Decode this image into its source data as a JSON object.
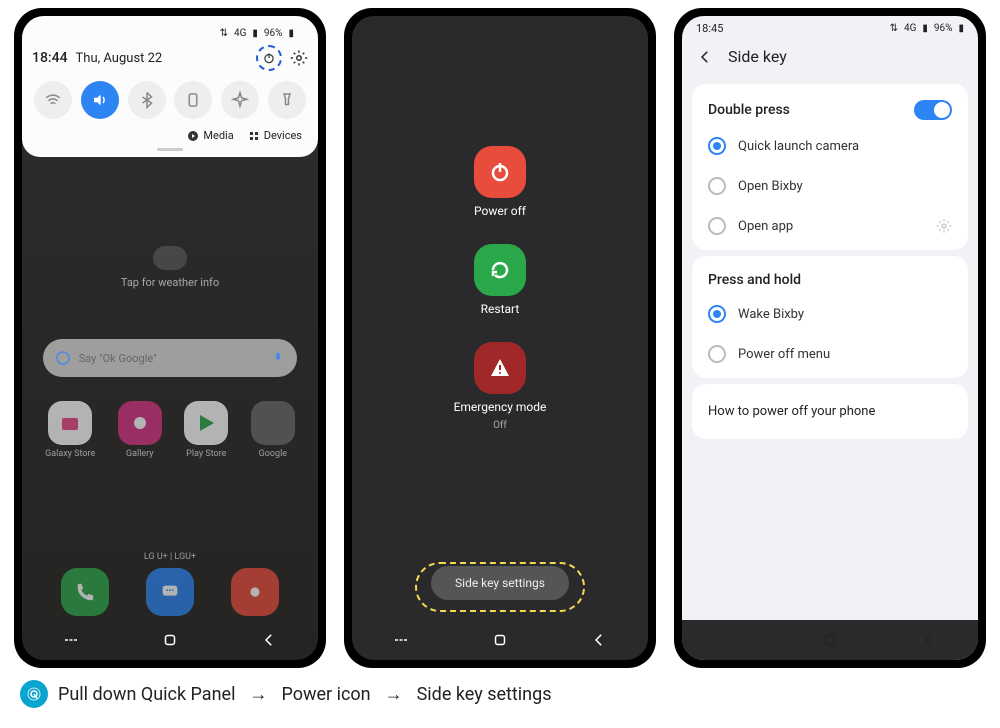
{
  "status": {
    "time": "18:45",
    "signal": "4G",
    "battery": "96%"
  },
  "phone1": {
    "qp_time": "18:44",
    "qp_date": "Thu, August 22",
    "media": "Media",
    "devices": "Devices",
    "weather_hint": "Tap for weather info",
    "search_placeholder": "Say \"Ok Google\"",
    "apps": [
      "Galaxy Store",
      "Gallery",
      "Play Store",
      "Google"
    ],
    "carrier": "LG U+ | LGU+"
  },
  "phone2": {
    "power_off": "Power off",
    "restart": "Restart",
    "emergency": "Emergency mode",
    "emergency_sub": "Off",
    "side_key": "Side key settings"
  },
  "phone3": {
    "title": "Side key",
    "section1": "Double press",
    "opt1": "Quick launch camera",
    "opt2": "Open Bixby",
    "opt3": "Open app",
    "section2": "Press and hold",
    "opt4": "Wake Bixby",
    "opt5": "Power off menu",
    "link": "How to power off your phone"
  },
  "caption": {
    "step1": "Pull down Quick Panel",
    "step2": "Power icon",
    "step3": "Side key settings"
  }
}
